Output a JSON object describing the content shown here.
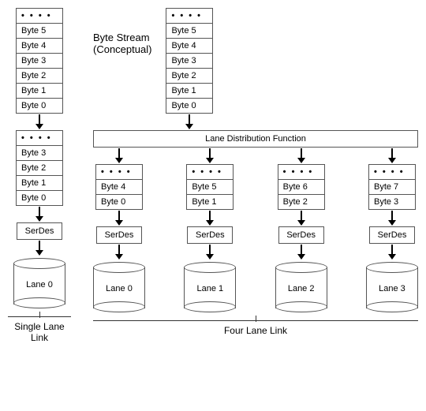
{
  "byteStreamTitle1": "Byte Stream",
  "byteStreamTitle2": "(Conceptual)",
  "dots": "• • • •",
  "leftStream": [
    "Byte 5",
    "Byte 4",
    "Byte 3",
    "Byte 2",
    "Byte 1",
    "Byte 0"
  ],
  "leftLaneBuf": [
    "Byte 3",
    "Byte 2",
    "Byte 1",
    "Byte 0"
  ],
  "serdesLabel": "SerDes",
  "laneLeft": "Lane 0",
  "singleLaneCaption": "Single Lane Link",
  "rightStream": [
    "Byte 5",
    "Byte 4",
    "Byte 3",
    "Byte 2",
    "Byte 1",
    "Byte 0"
  ],
  "distFn": "Lane Distribution Function",
  "lanes": [
    {
      "name": "Lane 0",
      "buf": [
        "Byte 4",
        "Byte 0"
      ]
    },
    {
      "name": "Lane 1",
      "buf": [
        "Byte 5",
        "Byte 1"
      ]
    },
    {
      "name": "Lane 2",
      "buf": [
        "Byte 6",
        "Byte 2"
      ]
    },
    {
      "name": "Lane 3",
      "buf": [
        "Byte 7",
        "Byte 3"
      ]
    }
  ],
  "fourLaneCaption": "Four Lane Link"
}
